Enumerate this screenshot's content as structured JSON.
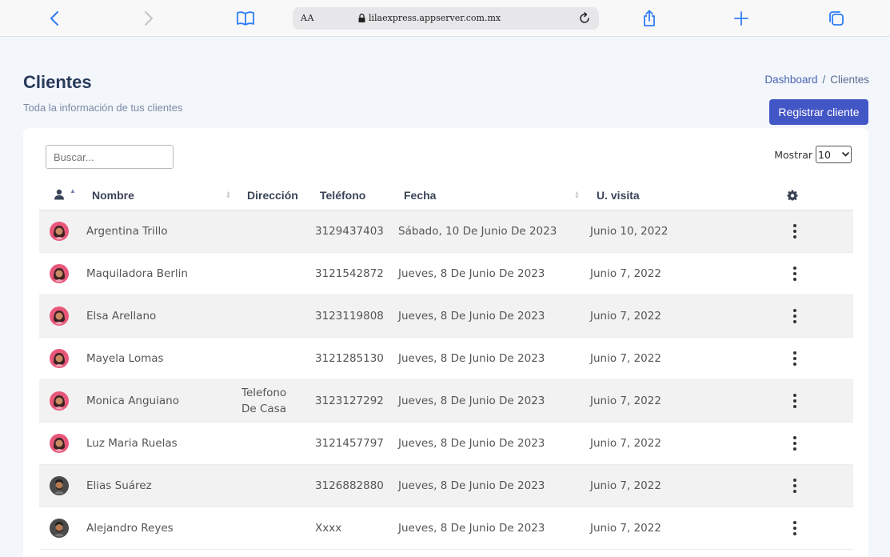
{
  "browser": {
    "text_size": "AA",
    "url": "lilaexpress.appserver.com.mx"
  },
  "header": {
    "title": "Clientes",
    "subtitle": "Toda la información de tus clientes",
    "breadcrumb": [
      "Dashboard",
      "/",
      "Clientes"
    ],
    "register_label": "Registrar cliente"
  },
  "table_controls": {
    "search_placeholder": "Buscar...",
    "show_label": "Mostrar",
    "show_value": "10"
  },
  "table": {
    "columns": [
      "Nombre",
      "Dirección",
      "Teléfono",
      "Fecha",
      "U. visita"
    ],
    "rows": [
      {
        "avatar": "female-avatar",
        "name": "Argentina Trillo",
        "address": "",
        "address2": "",
        "phone": "3129437403",
        "date": "Sábado, 10 De Junio De 2023",
        "visit": "Junio 10, 2022"
      },
      {
        "avatar": "female-avatar",
        "name": "Maquiladora Berlin",
        "address": "",
        "address2": "",
        "phone": "3121542872",
        "date": "Jueves, 8 De Junio De 2023",
        "visit": "Junio 7, 2022"
      },
      {
        "avatar": "female-avatar",
        "name": "Elsa Arellano",
        "address": "",
        "address2": "",
        "phone": "3123119808",
        "date": "Jueves, 8 De Junio De 2023",
        "visit": "Junio 7, 2022"
      },
      {
        "avatar": "female-avatar",
        "name": "Mayela Lomas",
        "address": "",
        "address2": "",
        "phone": "3121285130",
        "date": "Jueves, 8 De Junio De 2023",
        "visit": "Junio 7, 2022"
      },
      {
        "avatar": "female-avatar",
        "name": "Monica Anguiano",
        "address": "Telefono",
        "address2": "De Casa",
        "phone": "3123127292",
        "date": "Jueves, 8 De Junio De 2023",
        "visit": "Junio 7, 2022"
      },
      {
        "avatar": "female-avatar",
        "name": "Luz Maria Ruelas",
        "address": "",
        "address2": "",
        "phone": "3121457797",
        "date": "Jueves, 8 De Junio De 2023",
        "visit": "Junio 7, 2022"
      },
      {
        "avatar": "male-avatar",
        "name": "Elias Suárez",
        "address": "",
        "address2": "",
        "phone": "3126882880",
        "date": "Jueves, 8 De Junio De 2023",
        "visit": "Junio 7, 2022"
      },
      {
        "avatar": "male-avatar",
        "name": "Alejandro Reyes",
        "address": "",
        "address2": "",
        "phone": "Xxxx",
        "date": "Jueves, 8 De Junio De 2023",
        "visit": "Junio 7, 2022"
      }
    ]
  },
  "colors": {
    "primary": "#4356c6",
    "title": "#283a5c",
    "female_avatar": "#e8577a",
    "male_avatar": "#4a4a4a"
  }
}
